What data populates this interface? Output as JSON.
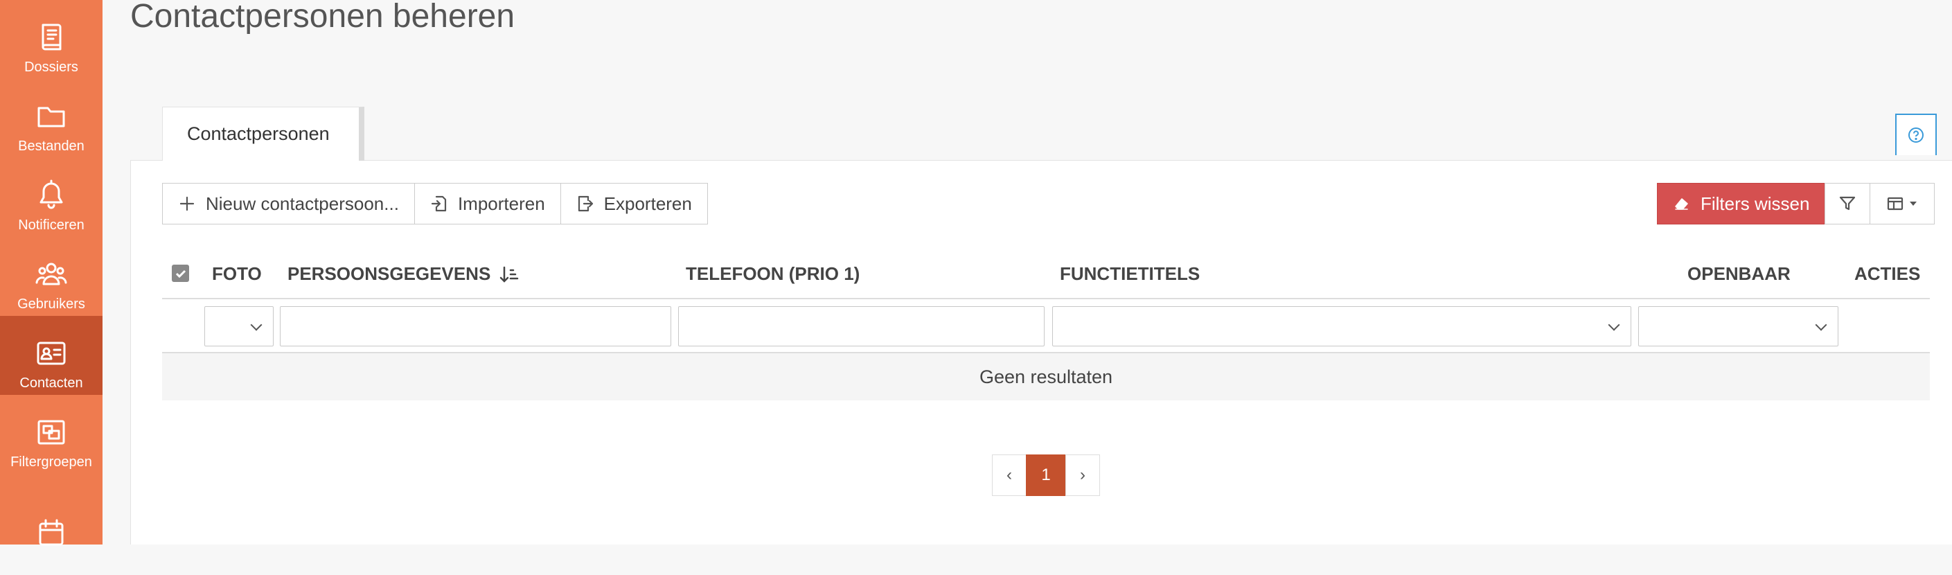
{
  "page": {
    "title": "Contactpersonen beheren"
  },
  "sidebar": {
    "items": [
      {
        "label": "Dossiers",
        "icon": "book-icon"
      },
      {
        "label": "Bestanden",
        "icon": "folder-icon"
      },
      {
        "label": "Notificeren",
        "icon": "bell-icon"
      },
      {
        "label": "Gebruikers",
        "icon": "users-icon"
      },
      {
        "label": "Contacten",
        "icon": "contact-card-icon",
        "active": true
      },
      {
        "label": "Filtergroepen",
        "icon": "filter-group-icon"
      },
      {
        "label": "",
        "icon": "calendar-icon"
      }
    ]
  },
  "tabs": [
    {
      "label": "Contactpersonen"
    }
  ],
  "toolbar": {
    "new_label": "Nieuw contactpersoon...",
    "import_label": "Importeren",
    "export_label": "Exporteren",
    "clear_filters_label": "Filters wissen"
  },
  "table": {
    "columns": [
      "FOTO",
      "PERSOONSGEGEVENS",
      "TELEFOON (PRIO 1)",
      "FUNCTIETITELS",
      "OPENBAAR",
      "ACTIES"
    ],
    "empty_text": "Geen resultaten"
  },
  "pagination": {
    "prev": "‹",
    "current": "1",
    "next": "›"
  },
  "colors": {
    "sidebar": "#ef7b4f",
    "sidebar_active": "#c4512d",
    "danger": "#d55050",
    "help": "#3a9ad9"
  }
}
